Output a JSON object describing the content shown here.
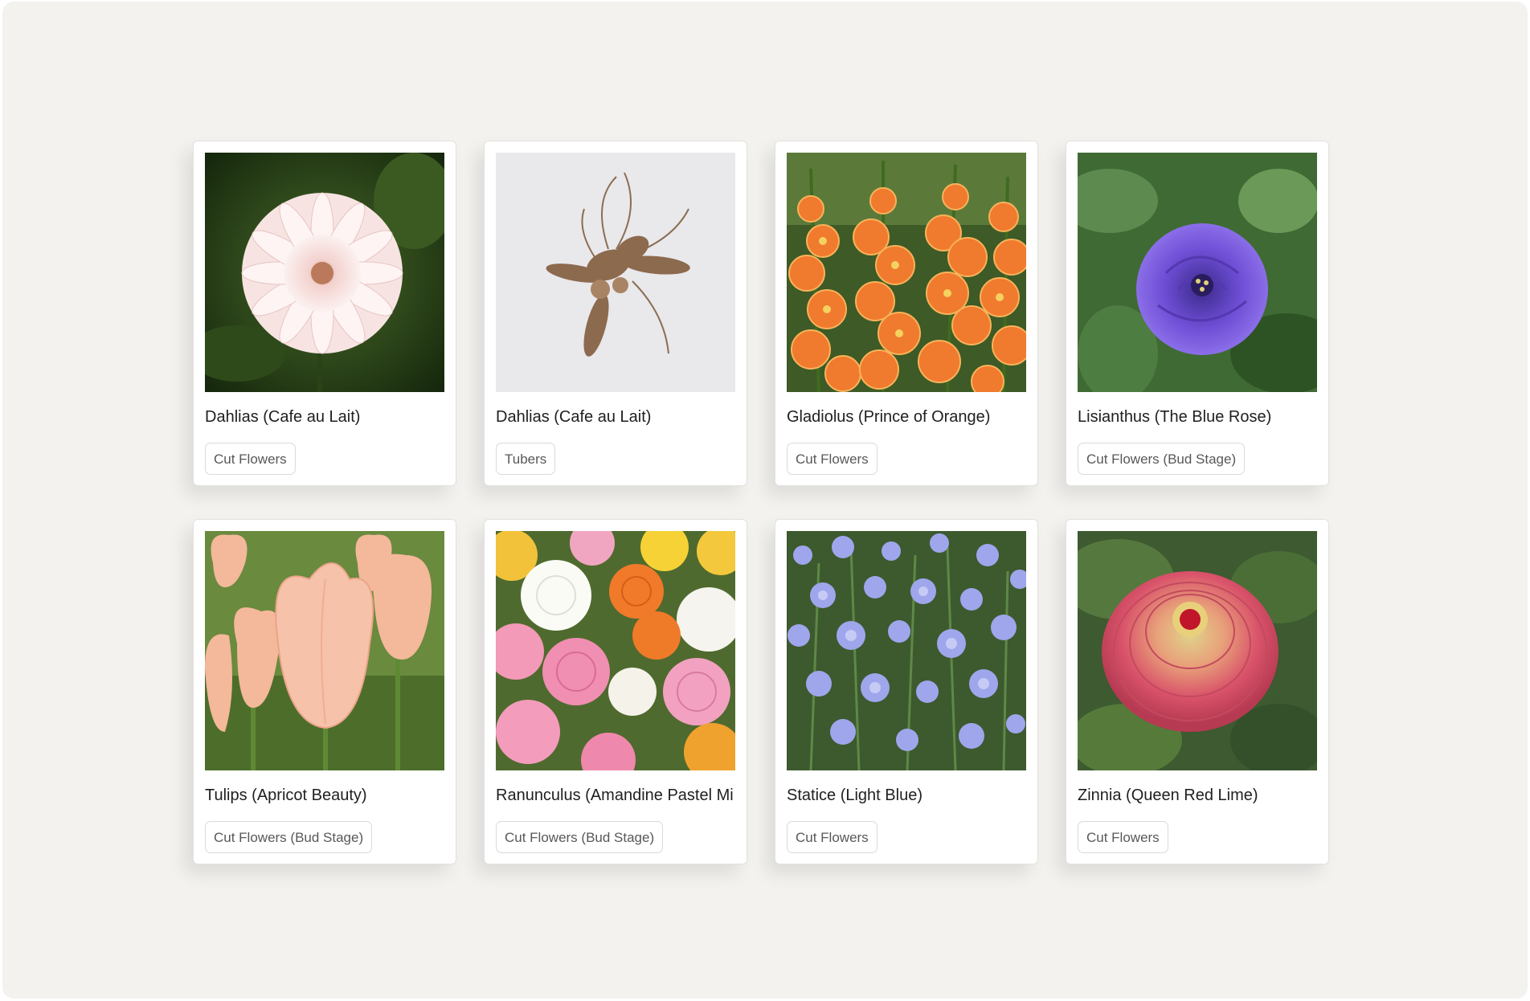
{
  "products": [
    {
      "title": "Dahlias (Cafe au Lait)",
      "tag": "Cut Flowers",
      "photo_icon": "dahlia-bloom-photo"
    },
    {
      "title": "Dahlias (Cafe au Lait)",
      "tag": "Tubers",
      "photo_icon": "dahlia-tuber-photo"
    },
    {
      "title": "Gladiolus (Prince of Orange)",
      "tag": "Cut Flowers",
      "photo_icon": "gladiolus-photo"
    },
    {
      "title": "Lisianthus (The Blue Rose)",
      "tag": "Cut Flowers (Bud Stage)",
      "photo_icon": "lisianthus-photo"
    },
    {
      "title": "Tulips (Apricot Beauty)",
      "tag": "Cut Flowers (Bud Stage)",
      "photo_icon": "tulip-photo"
    },
    {
      "title": "Ranunculus (Amandine Pastel Mi",
      "tag": "Cut Flowers (Bud Stage)",
      "photo_icon": "ranunculus-photo"
    },
    {
      "title": "Statice (Light Blue)",
      "tag": "Cut Flowers",
      "photo_icon": "statice-photo"
    },
    {
      "title": "Zinnia (Queen Red Lime)",
      "tag": "Cut Flowers",
      "photo_icon": "zinnia-photo"
    }
  ],
  "colors": {
    "page_background": "#f3f2ef",
    "card_background": "#ffffff",
    "card_border": "#e3e1dc",
    "title_text": "#1f1f1f",
    "tag_text": "#585858",
    "tag_border": "#dcdad6"
  }
}
